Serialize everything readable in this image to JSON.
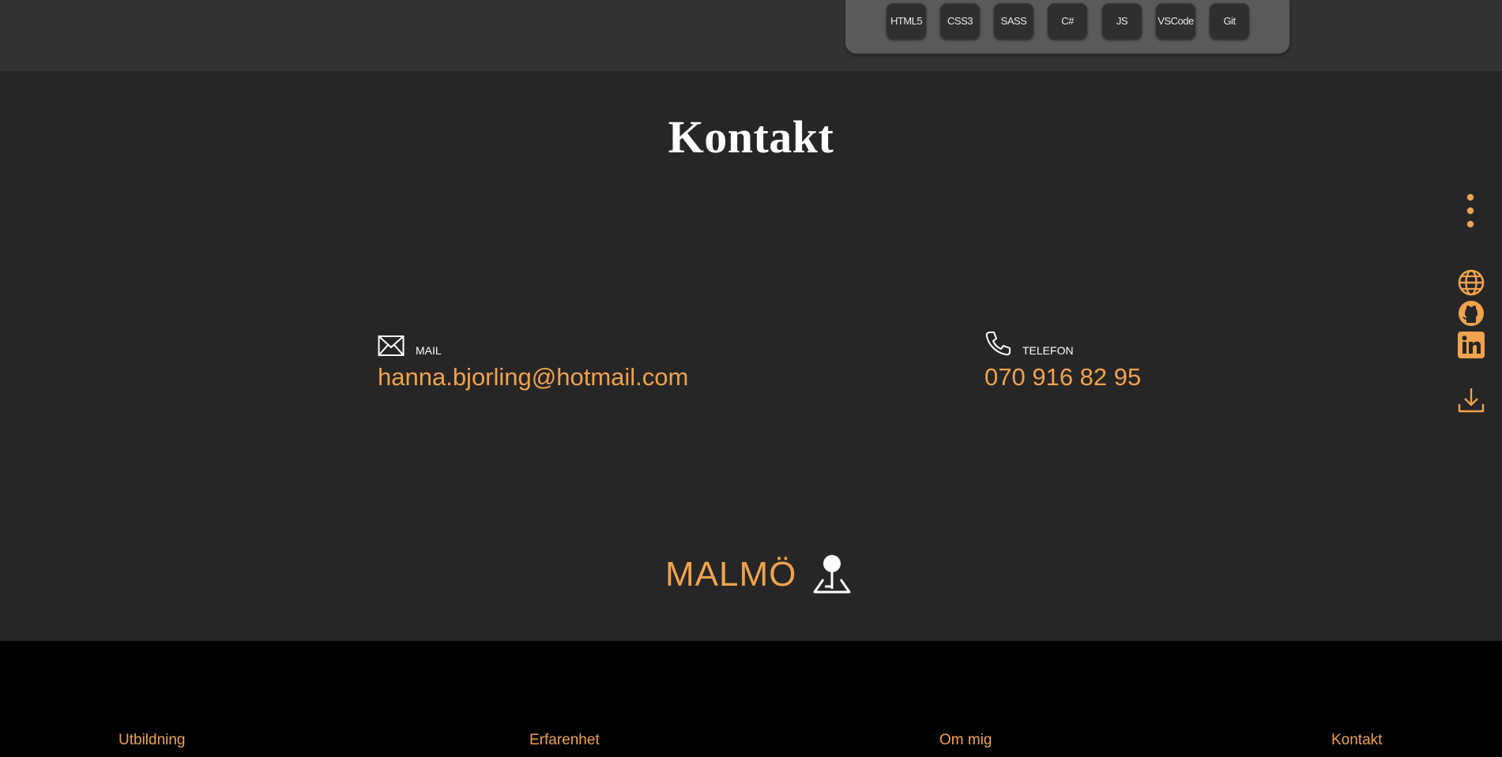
{
  "skills": [
    "HTML5",
    "CSS3",
    "SASS",
    "C#",
    "JS",
    "VSCode",
    "Git"
  ],
  "section": {
    "title": "Kontakt"
  },
  "contact": {
    "mail": {
      "label": "MAIL",
      "value": "hanna.bjorling@hotmail.com",
      "icon": "envelope-icon"
    },
    "phone": {
      "label": "TELEFON",
      "value": "070 916 82 95",
      "icon": "phone-icon"
    }
  },
  "location": {
    "city": "MALMÖ",
    "icon": "map-pin-icon"
  },
  "sidebar": {
    "icons": [
      "more-vertical-icon",
      "globe-icon",
      "github-icon",
      "linkedin-icon",
      "download-icon"
    ]
  },
  "footer": {
    "links": [
      "Utbildning",
      "Erfarenhet",
      "Om mig",
      "Kontakt"
    ]
  },
  "colors": {
    "accent": "#f0a24e",
    "background": "#262626",
    "top_band": "#333333",
    "footer": "#000000"
  }
}
